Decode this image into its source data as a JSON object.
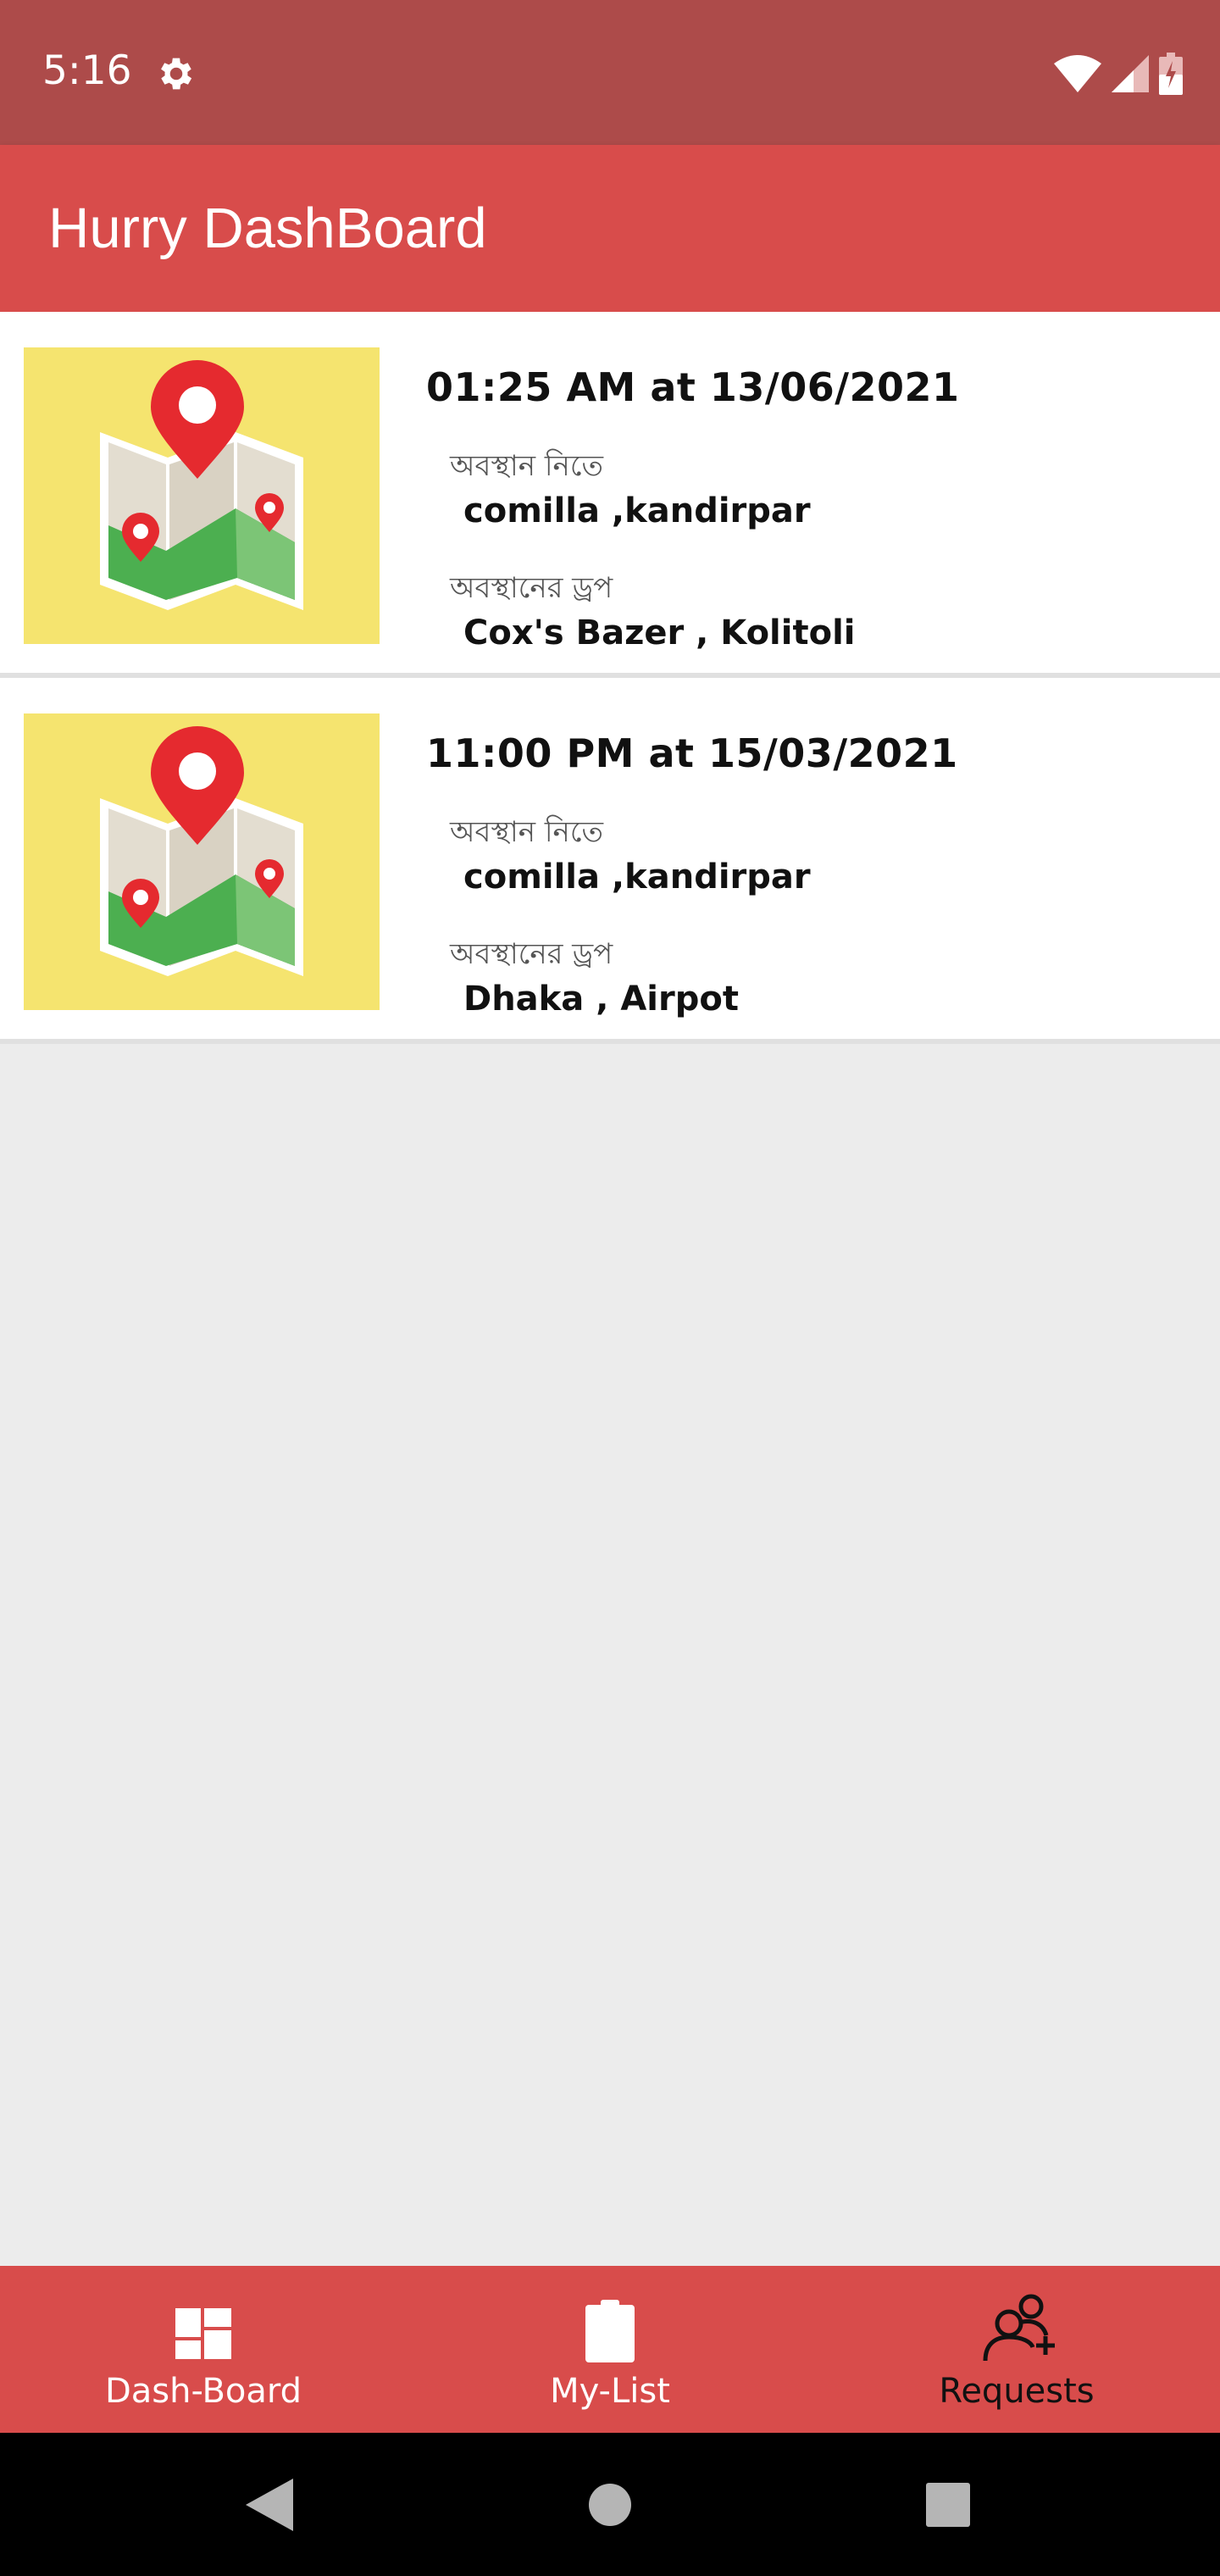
{
  "status_bar": {
    "time": "5:16",
    "icons": [
      "gear-icon",
      "wifi-icon",
      "signal-icon",
      "battery-charging-icon"
    ]
  },
  "app_bar": {
    "title": "Hurry DashBoard"
  },
  "colors": {
    "status_bar": "#ad4b4a",
    "accent": "#d84c4b",
    "thumb_bg": "#f5e46f",
    "pin_red": "#e52a2f",
    "map_green": "#4caf50"
  },
  "rides": [
    {
      "title": "01:25 AM at 13/06/2021",
      "pickup_label": "অবস্থান নিতে",
      "pickup_value": "comilla ,kandirpar",
      "drop_label": "অবস্থানের ড্রপ",
      "drop_value": "Cox's Bazer , Kolitoli",
      "icon": "map-pin-icon"
    },
    {
      "title": "11:00 PM at 15/03/2021",
      "pickup_label": "অবস্থান নিতে",
      "pickup_value": "comilla ,kandirpar",
      "drop_label": "অবস্থানের ড্রপ",
      "drop_value": "Dhaka , Airpot",
      "icon": "map-pin-icon"
    }
  ],
  "bottom_nav": {
    "items": [
      {
        "label": "Dash-Board",
        "icon": "dashboard-icon"
      },
      {
        "label": "My-List",
        "icon": "clipboard-icon"
      },
      {
        "label": "Requests",
        "icon": "add-user-icon",
        "active": true
      }
    ]
  },
  "system_nav": [
    "back-icon",
    "home-icon",
    "recents-icon"
  ]
}
